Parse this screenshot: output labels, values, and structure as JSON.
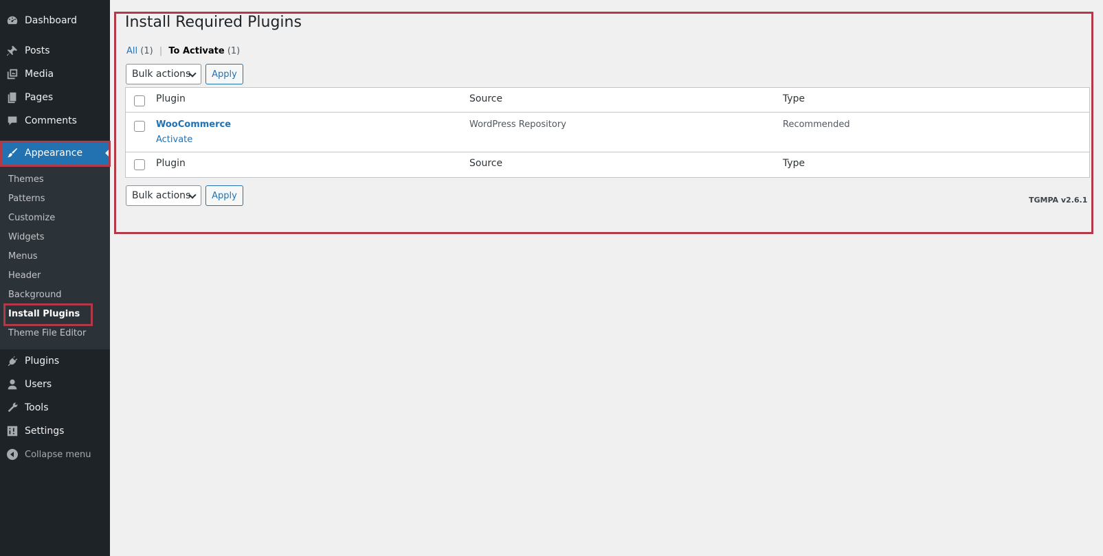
{
  "sidebar": {
    "items": [
      {
        "name": "dashboard",
        "label": "Dashboard",
        "icon": "dashboard-icon"
      },
      {
        "name": "posts",
        "label": "Posts",
        "icon": "pin-icon"
      },
      {
        "name": "media",
        "label": "Media",
        "icon": "media-icon"
      },
      {
        "name": "pages",
        "label": "Pages",
        "icon": "pages-icon"
      },
      {
        "name": "comments",
        "label": "Comments",
        "icon": "comment-icon"
      },
      {
        "name": "appearance",
        "label": "Appearance",
        "icon": "paintbrush-icon",
        "active": true
      }
    ],
    "submenu": [
      {
        "label": "Themes"
      },
      {
        "label": "Patterns"
      },
      {
        "label": "Customize"
      },
      {
        "label": "Widgets"
      },
      {
        "label": "Menus"
      },
      {
        "label": "Header"
      },
      {
        "label": "Background"
      },
      {
        "label": "Install Plugins",
        "current": true
      },
      {
        "label": "Theme File Editor"
      }
    ],
    "items_after": [
      {
        "name": "plugins",
        "label": "Plugins",
        "icon": "plugin-icon"
      },
      {
        "name": "users",
        "label": "Users",
        "icon": "user-icon"
      },
      {
        "name": "tools",
        "label": "Tools",
        "icon": "wrench-icon"
      },
      {
        "name": "settings",
        "label": "Settings",
        "icon": "settings-icon"
      }
    ],
    "collapse_label": "Collapse menu"
  },
  "main": {
    "title": "Install Required Plugins",
    "filters": {
      "all_label": "All",
      "all_count": "(1)",
      "separator": "|",
      "to_activate_label": "To Activate",
      "to_activate_count": "(1)"
    },
    "bulk_actions_label": "Bulk actions",
    "apply_label": "Apply",
    "table": {
      "columns": [
        "Plugin",
        "Source",
        "Type"
      ],
      "rows": [
        {
          "plugin": "WooCommerce",
          "action": "Activate",
          "source": "WordPress Repository",
          "type": "Recommended"
        }
      ]
    },
    "version": "TGMPA v2.6.1"
  },
  "colors": {
    "sidebar_bg": "#1d2327",
    "submenu_bg": "#2c3338",
    "accent": "#2271b1",
    "highlight": "#b03a48",
    "page_bg": "#f0f0f1"
  }
}
